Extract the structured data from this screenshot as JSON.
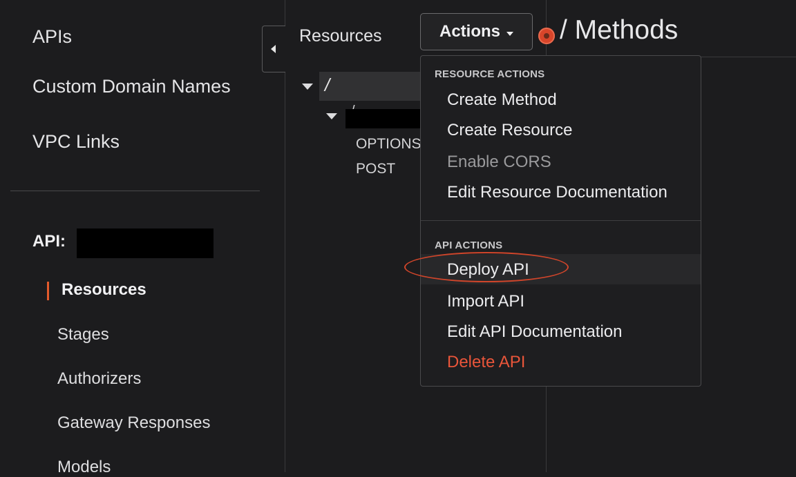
{
  "sidebar": {
    "top_items": [
      "APIs",
      "Custom Domain Names",
      "VPC Links"
    ],
    "api_label": "API:",
    "sub_items": [
      "Resources",
      "Stages",
      "Authorizers",
      "Gateway Responses",
      "Models"
    ],
    "active_sub_item": "Resources"
  },
  "resources": {
    "title": "Resources",
    "root": "/",
    "child": "/",
    "methods": [
      "OPTIONS",
      "POST"
    ]
  },
  "header": {
    "actions_label": "Actions",
    "methods_title": "/ Methods"
  },
  "dropdown": {
    "resource_section": "RESOURCE ACTIONS",
    "resource_items": [
      "Create Method",
      "Create Resource",
      "Enable CORS",
      "Edit Resource Documentation"
    ],
    "api_section": "API ACTIONS",
    "api_items": [
      "Deploy API",
      "Import API",
      "Edit API Documentation",
      "Delete API"
    ]
  },
  "colors": {
    "background": "#1c1c1e",
    "accent": "#e35a2b",
    "danger": "#e9553a"
  }
}
